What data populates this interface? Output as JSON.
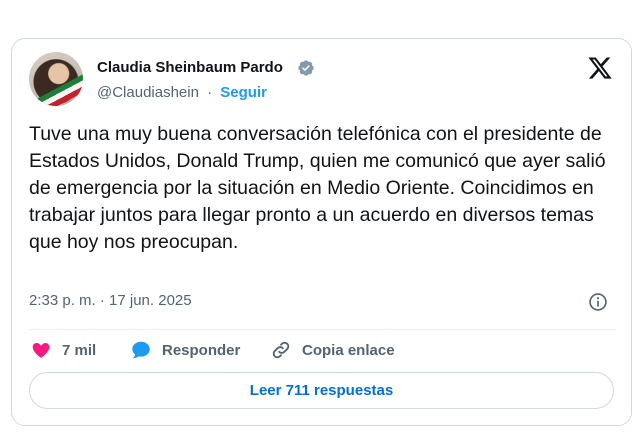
{
  "author": {
    "name": "Claudia Sheinbaum Pardo",
    "handle": "@Claudiashein",
    "separator": "·",
    "follow_label": "Seguir"
  },
  "tweet": {
    "text": "Tuve una muy buena conversación telefónica con el presidente de Estados Unidos, Donald Trump, quien me comunicó que ayer salió de emergencia por la situación en Medio Oriente. Coincidimos en trabajar juntos para llegar pronto a un acuerdo en diversos temas que hoy nos preocupan.",
    "timestamp": "2:33 p. m. · 17 jun. 2025"
  },
  "actions": {
    "likes_count": "7 mil",
    "reply_label": "Responder",
    "copy_label": "Copia enlace"
  },
  "replies_button": "Leer 711 respuestas",
  "icons": {
    "verified": "verified-badge-icon",
    "platform": "x-logo-icon",
    "info": "info-icon",
    "like": "heart-icon",
    "reply": "speech-bubble-icon",
    "copy": "link-icon"
  },
  "colors": {
    "accent": "#1d9bf0",
    "like": "#f91880",
    "secondary_text": "#536471",
    "border": "#cfd9de"
  }
}
